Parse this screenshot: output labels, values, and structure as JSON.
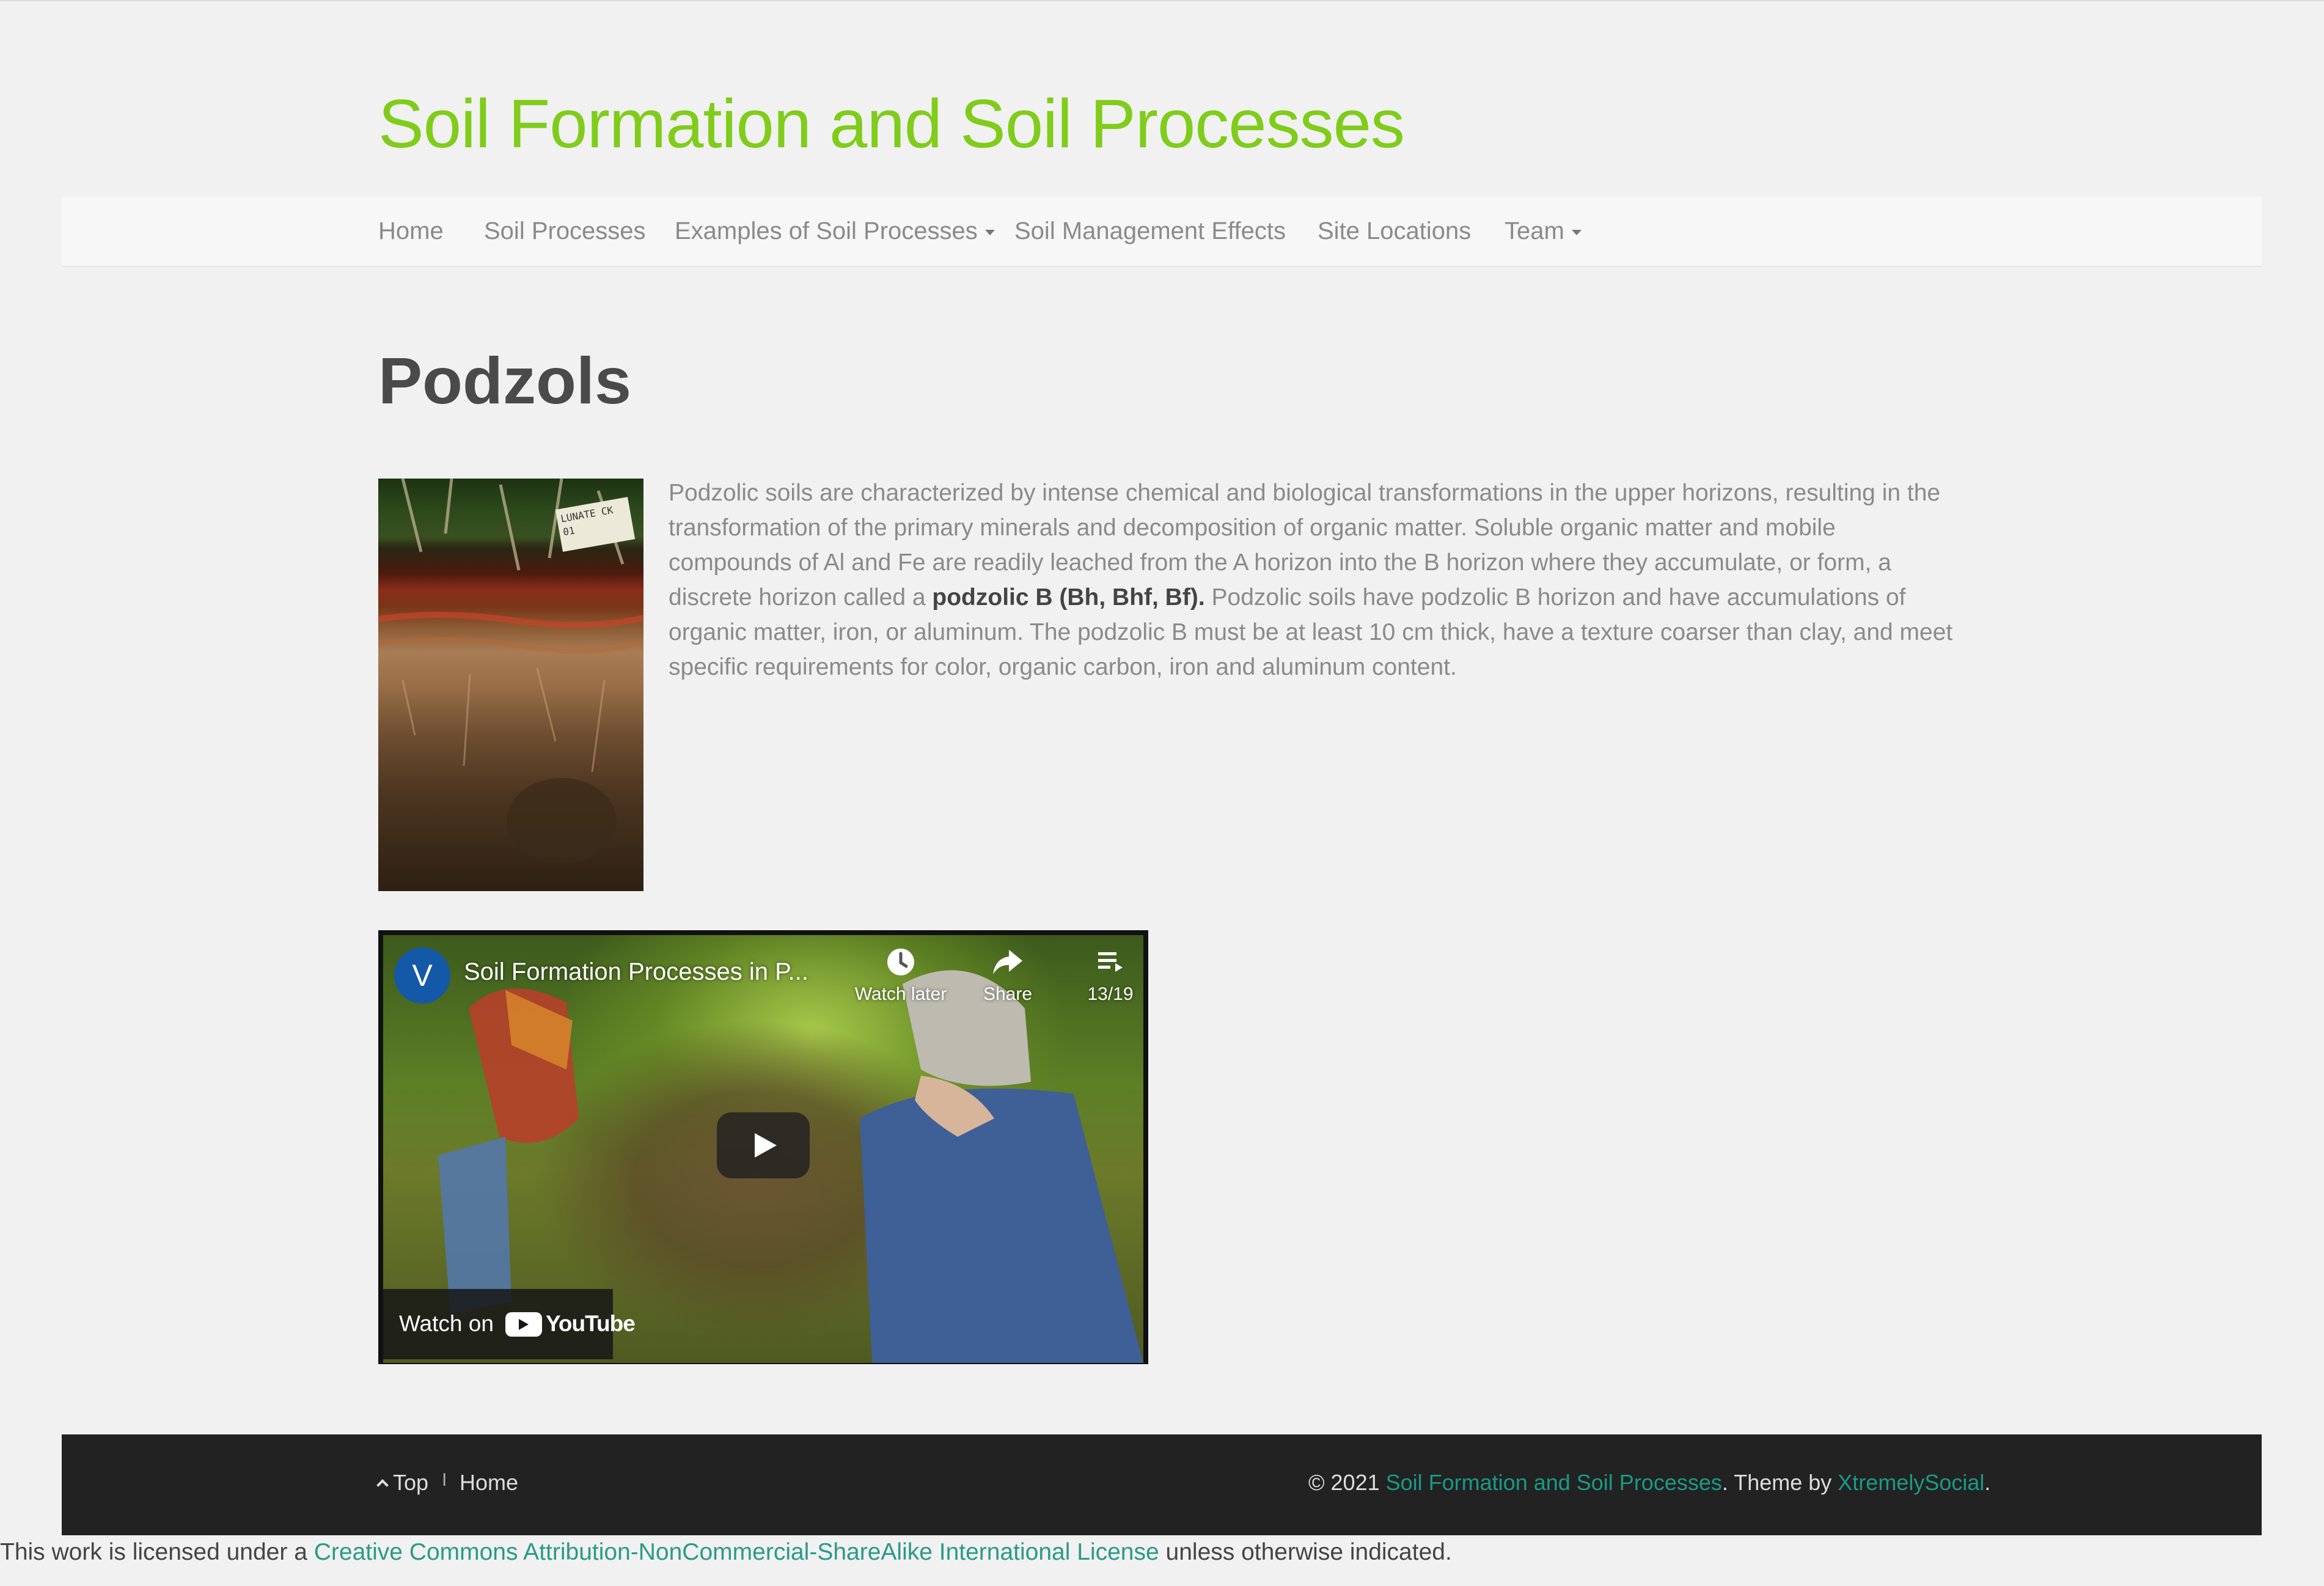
{
  "site": {
    "title": "Soil Formation and Soil Processes"
  },
  "nav": {
    "items": [
      {
        "label": "Home"
      },
      {
        "label": "Soil Processes"
      },
      {
        "label": "Examples of Soil Processes",
        "has_dropdown": true
      },
      {
        "label": "Soil Management Effects"
      },
      {
        "label": "Site Locations"
      },
      {
        "label": "Team",
        "has_dropdown": true
      }
    ]
  },
  "page": {
    "title": "Podzols",
    "paragraph": {
      "before": "Podzolic soils are characterized by intense chemical and biological transformations in the upper horizons, resulting in the transformation of the primary minerals and decomposition of organic matter. Soluble organic matter and mobile compounds of Al and Fe are readily leached from the A horizon into the B horizon where they accumulate, or form, a discrete horizon called a ",
      "bold": "podzolic B (Bh, Bhf, Bf).",
      "after": " Podzolic soils have podzolic B horizon and have accumulations of organic matter, iron, or aluminum. The podzolic B must be at least 10 cm thick, have a texture coarser than clay, and meet specific requirements for color, organic carbon, iron and aluminum content."
    },
    "photo_sign_text": "LUNATE CK\n01"
  },
  "video": {
    "channel_initial": "V",
    "title": "Soil Formation Processes in P...",
    "watch_later_label": "Watch later",
    "share_label": "Share",
    "playlist_label": "13/19",
    "watch_on_label": "Watch on",
    "youtube_label": "YouTube"
  },
  "footer": {
    "top_label": "Top",
    "separator": "I",
    "home_label": "Home",
    "copyright_prefix": "© 2021 ",
    "site_link": "Soil Formation and Soil Processes",
    "theme_text": ". Theme by ",
    "theme_link": "XtremelySocial",
    "period": "."
  },
  "license": {
    "prefix": "This work is licensed under a ",
    "link": "Creative Commons Attribution-NonCommercial-ShareAlike International License",
    "suffix": " unless otherwise indicated."
  },
  "colors": {
    "accent_green": "#80cc1a",
    "link_teal": "#1a9a85",
    "footer_bg": "#222222",
    "page_bg": "#f1f1f1"
  }
}
